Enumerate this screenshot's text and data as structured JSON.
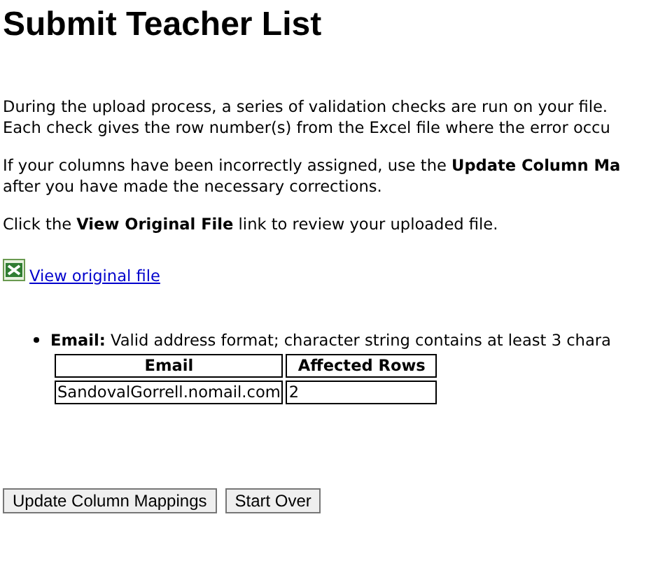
{
  "title": "Submit Teacher List",
  "paragraphs": [
    [
      "During the upload process, a series of validation checks are run on your file.",
      "Each check gives the row number(s) from the Excel file where the error occu"
    ],
    [
      "If your columns have been incorrectly assigned, use the **Update Column Ma**",
      "after you have made the necessary corrections."
    ],
    [
      "Click the **View Original File** link to review your uploaded file."
    ]
  ],
  "file_link": {
    "label": "View original file"
  },
  "errors": [
    {
      "field": "Email:",
      "description": "Valid address format; character string contains at least 3 chara",
      "table": {
        "columns": [
          "Email",
          "Affected Rows"
        ],
        "rows": [
          [
            "SandovalGorrell.nomail.com",
            "2"
          ]
        ]
      }
    }
  ],
  "buttons": [
    "Update Column Mappings",
    "Start Over"
  ]
}
